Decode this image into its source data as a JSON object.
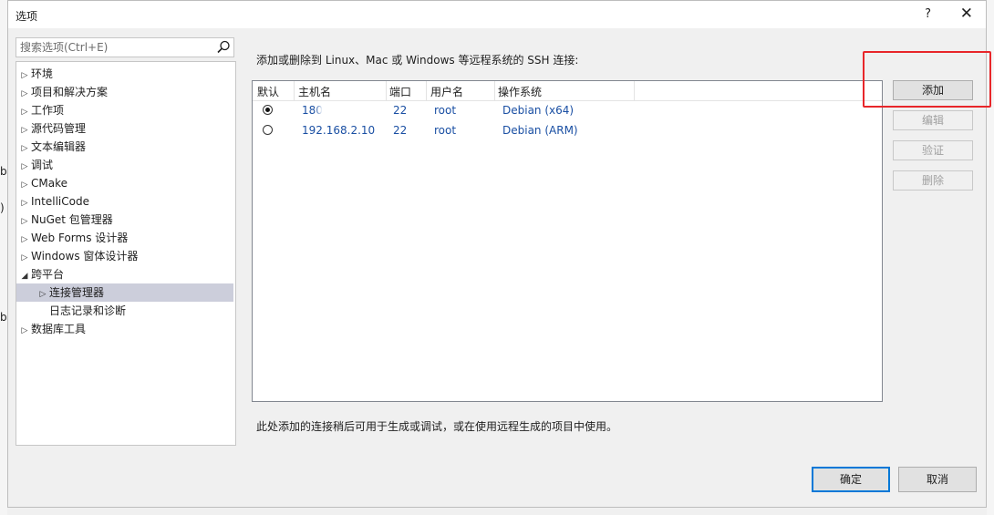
{
  "window": {
    "title": "选项",
    "help_glyph": "?",
    "close_glyph": "✕"
  },
  "search": {
    "placeholder": "搜索选项(Ctrl+E)"
  },
  "tree": {
    "items": [
      {
        "label": "环境"
      },
      {
        "label": "项目和解决方案"
      },
      {
        "label": "工作项"
      },
      {
        "label": "源代码管理"
      },
      {
        "label": "文本编辑器"
      },
      {
        "label": "调试"
      },
      {
        "label": "CMake"
      },
      {
        "label": "IntelliCode"
      },
      {
        "label": "NuGet 包管理器"
      },
      {
        "label": "Web Forms 设计器"
      },
      {
        "label": "Windows 窗体设计器"
      },
      {
        "label": "跨平台"
      },
      {
        "label": "连接管理器"
      },
      {
        "label": "日志记录和诊断"
      },
      {
        "label": "数据库工具"
      }
    ]
  },
  "main": {
    "description": "添加或删除到 Linux、Mac 或 Windows 等远程系统的 SSH 连接:",
    "columns": [
      "默认",
      "主机名",
      "端口",
      "用户名",
      "操作系统"
    ],
    "rows": [
      {
        "default": true,
        "host": "180",
        "port": "22",
        "user": "root",
        "os": "Debian (x64)"
      },
      {
        "default": false,
        "host": "192.168.2.10",
        "port": "22",
        "user": "root",
        "os": "Debian (ARM)"
      }
    ],
    "note": "此处添加的连接稍后可用于生成或调试，或在使用远程生成的项目中使用。"
  },
  "buttons": {
    "add": "添加",
    "edit": "编辑",
    "verify": "验证",
    "delete": "删除",
    "ok": "确定",
    "cancel": "取消"
  },
  "background": {
    "edge_glyphs": [
      "b",
      ")",
      "b"
    ]
  },
  "colors": {
    "selection": "#cccedb",
    "link_text": "#1a4fa3",
    "highlight_box": "#e8262a",
    "primary_border": "#0078d7"
  }
}
